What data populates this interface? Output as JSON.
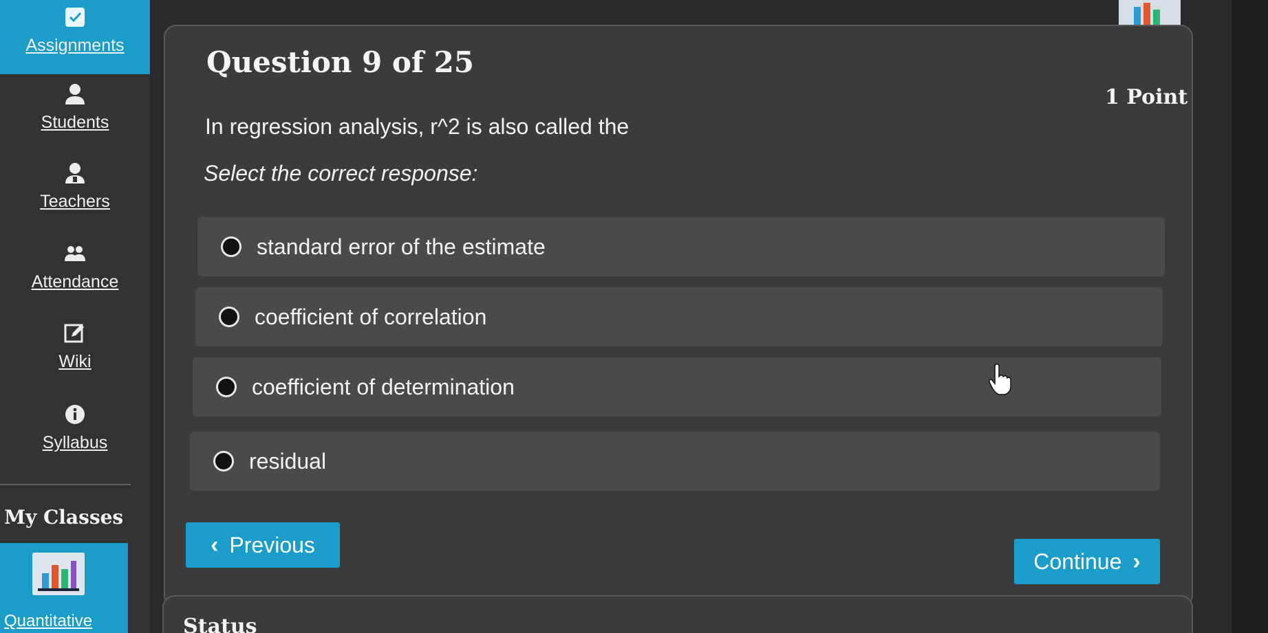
{
  "sidebar": {
    "items": [
      {
        "label": "Assignments",
        "icon": "assignments-icon",
        "active": true
      },
      {
        "label": "Students",
        "icon": "student-icon",
        "active": false
      },
      {
        "label": "Teachers",
        "icon": "teacher-icon",
        "active": false
      },
      {
        "label": "Attendance",
        "icon": "attendance-icon",
        "active": false
      },
      {
        "label": "Wiki",
        "icon": "wiki-edit-icon",
        "active": false
      },
      {
        "label": "Syllabus",
        "icon": "info-icon",
        "active": false
      }
    ],
    "section_title": "My Classes",
    "class_label": "Quantitative"
  },
  "question": {
    "title": "Question 9 of 25",
    "points": "1 Point",
    "text": "In regression analysis, r^2 is also called the",
    "instruction": "Select the correct response:",
    "options": [
      {
        "label": "standard error of the estimate"
      },
      {
        "label": "coefficient of correlation"
      },
      {
        "label": "coefficient of determination"
      },
      {
        "label": "residual"
      }
    ]
  },
  "buttons": {
    "previous": "Previous",
    "continue": "Continue"
  },
  "status": {
    "title": "Status"
  },
  "colors": {
    "accent": "#1a9ec9",
    "card": "#3b3b3d",
    "option": "#4a4a4c"
  }
}
